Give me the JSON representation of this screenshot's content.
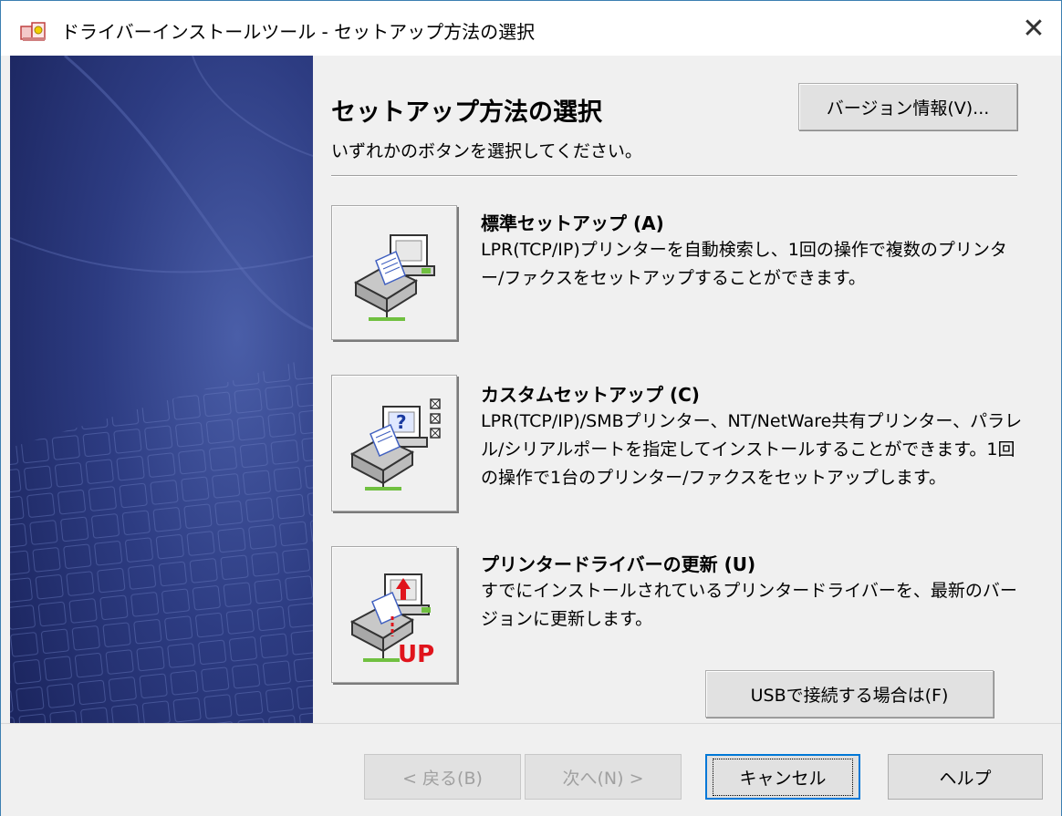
{
  "window": {
    "title": "ドライバーインストールツール - セットアップ方法の選択",
    "close_glyph": "✕"
  },
  "header": {
    "heading": "セットアップ方法の選択",
    "subheading": "いずれかのボタンを選択してください。",
    "version_button": "バージョン情報(V)..."
  },
  "options": [
    {
      "title": "標準セットアップ (A)",
      "description": "LPR(TCP/IP)プリンターを自動検索し、1回の操作で複数のプリンター/ファクスをセットアップすることができます。",
      "icon": "printer-computer-icon"
    },
    {
      "title": "カスタムセットアップ (C)",
      "description": "LPR(TCP/IP)/SMBプリンター、NT/NetWare共有プリンター、パラレル/シリアルポートを指定してインストールすることができます。1回の操作で1台のプリンター/ファクスをセットアップします。",
      "icon": "printer-question-icon"
    },
    {
      "title": "プリンタードライバーの更新 (U)",
      "description": "すでにインストールされているプリンタードライバーを、最新のバージョンに更新します。",
      "icon": "printer-update-icon",
      "icon_text": "UP"
    }
  ],
  "usb_button": "USBで接続する場合は(F)",
  "footer": {
    "back": "< 戻る(B)",
    "next": "次へ(N) >",
    "cancel": "キャンセル",
    "help": "ヘルプ"
  },
  "colors": {
    "side_panel": "#2b3a78",
    "dialog_bg": "#f0f0f0",
    "up_red": "#e0141c"
  }
}
